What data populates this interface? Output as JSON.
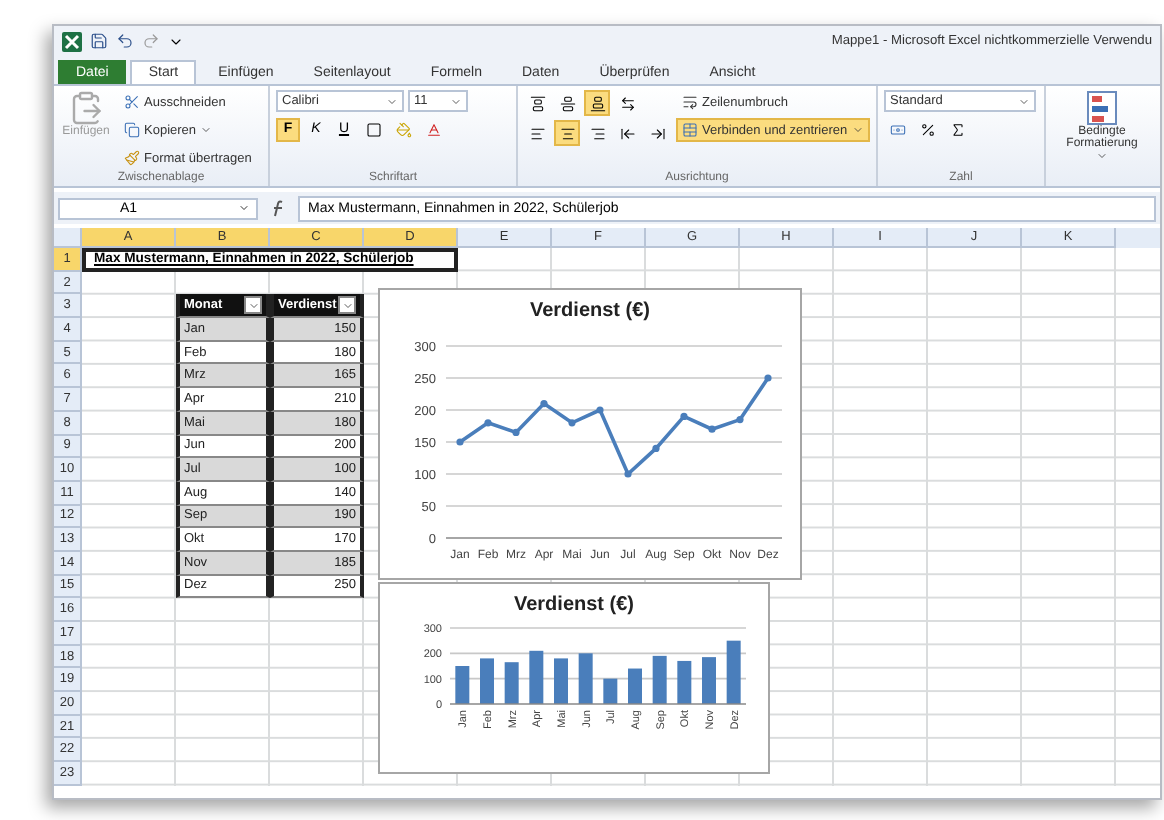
{
  "window": {
    "title": "Mappe1 - Microsoft Excel nichtkommerzielle Verwendu"
  },
  "ribbon_tabs": [
    {
      "label": "Datei",
      "kind": "file",
      "selected": false
    },
    {
      "label": "Start",
      "kind": "tab",
      "selected": true
    },
    {
      "label": "Einfügen",
      "kind": "tab",
      "selected": false
    },
    {
      "label": "Seitenlayout",
      "kind": "tab",
      "selected": false
    },
    {
      "label": "Formeln",
      "kind": "tab",
      "selected": false
    },
    {
      "label": "Daten",
      "kind": "tab",
      "selected": false
    },
    {
      "label": "Überprüfen",
      "kind": "tab",
      "selected": false
    },
    {
      "label": "Ansicht",
      "kind": "tab",
      "selected": false
    }
  ],
  "ribbon_groups": [
    {
      "kind": "clipboard",
      "label": "Zwischenablage",
      "paste": "Einfügen",
      "items": [
        "Ausschneiden",
        "Kopieren",
        "Format übertragen"
      ]
    },
    {
      "kind": "font",
      "label": "Schriftart",
      "font_name": "Calibri",
      "font_size": "11",
      "styles": [
        {
          "label": "F",
          "selected": true
        },
        {
          "label": "K",
          "selected": false
        },
        {
          "label": "U",
          "selected": false
        }
      ]
    },
    {
      "kind": "alignment",
      "label": "Ausrichtung",
      "wrap": "Zeilenumbruch",
      "merge": {
        "label": "Verbinden und zentrieren",
        "selected": true
      },
      "vertical": [
        {
          "selected": false
        },
        {
          "selected": false
        },
        {
          "selected": true
        }
      ],
      "horizontal": [
        {
          "selected": false
        },
        {
          "selected": true
        },
        {
          "selected": false
        }
      ]
    },
    {
      "kind": "number",
      "label": "Zahl",
      "format": "Standard"
    },
    {
      "kind": "styles",
      "label": "Bedingte Formatierung"
    }
  ],
  "formula_bar": {
    "name_box": "A1",
    "value": "Max Mustermann, Einnahmen in 2022, Schülerjob"
  },
  "sheet": {
    "columns": [
      {
        "label": "A",
        "selected": true
      },
      {
        "label": "B",
        "selected": true
      },
      {
        "label": "C",
        "selected": true
      },
      {
        "label": "D",
        "selected": true
      },
      {
        "label": "E",
        "selected": false
      },
      {
        "label": "F",
        "selected": false
      },
      {
        "label": "G",
        "selected": false
      },
      {
        "label": "H",
        "selected": false
      },
      {
        "label": "I",
        "selected": false
      },
      {
        "label": "J",
        "selected": false
      },
      {
        "label": "K",
        "selected": false
      }
    ],
    "row_numbers": [
      {
        "label": "1",
        "selected": true
      },
      {
        "label": "2",
        "selected": false
      },
      {
        "label": "3",
        "selected": false
      },
      {
        "label": "4",
        "selected": false
      },
      {
        "label": "5",
        "selected": false
      },
      {
        "label": "6",
        "selected": false
      },
      {
        "label": "7",
        "selected": false
      },
      {
        "label": "8",
        "selected": false
      },
      {
        "label": "9",
        "selected": false
      },
      {
        "label": "10",
        "selected": false
      },
      {
        "label": "11",
        "selected": false
      },
      {
        "label": "12",
        "selected": false
      },
      {
        "label": "13",
        "selected": false
      },
      {
        "label": "14",
        "selected": false
      },
      {
        "label": "15",
        "selected": false
      },
      {
        "label": "16",
        "selected": false
      },
      {
        "label": "17",
        "selected": false
      },
      {
        "label": "18",
        "selected": false
      },
      {
        "label": "19",
        "selected": false
      },
      {
        "label": "20",
        "selected": false
      },
      {
        "label": "21",
        "selected": false
      },
      {
        "label": "22",
        "selected": false
      },
      {
        "label": "23",
        "selected": false
      }
    ],
    "title_cell": {
      "text": "Max Mustermann, Einnahmen in 2022, Schülerjob",
      "selected": true
    }
  },
  "table": {
    "columns": [
      "Monat",
      "Verdienst"
    ],
    "rows": [
      [
        "Jan",
        "150"
      ],
      [
        "Feb",
        "180"
      ],
      [
        "Mrz",
        "165"
      ],
      [
        "Apr",
        "210"
      ],
      [
        "Mai",
        "180"
      ],
      [
        "Jun",
        "200"
      ],
      [
        "Jul",
        "100"
      ],
      [
        "Aug",
        "140"
      ],
      [
        "Sep",
        "190"
      ],
      [
        "Okt",
        "170"
      ],
      [
        "Nov",
        "185"
      ],
      [
        "Dez",
        "250"
      ]
    ]
  },
  "charts": [
    {
      "chart_data": {
        "type": "line",
        "title": "Verdienst (€)",
        "categories": [
          "Jan",
          "Feb",
          "Mrz",
          "Apr",
          "Mai",
          "Jun",
          "Jul",
          "Aug",
          "Sep",
          "Okt",
          "Nov",
          "Dez"
        ],
        "series": [
          {
            "color": "#4a7ebb",
            "marker": true,
            "values": [
              150,
              180,
              165,
              210,
              180,
              200,
              100,
              140,
              190,
              170,
              185,
              250
            ]
          }
        ],
        "ylim": [
          0,
          300
        ],
        "yticks": [
          0,
          50,
          100,
          150,
          200,
          250,
          300
        ],
        "grid": true
      }
    },
    {
      "chart_data": {
        "type": "bar",
        "title": "Verdienst (€)",
        "categories": [
          "Jan",
          "Feb",
          "Mrz",
          "Apr",
          "Mai",
          "Jun",
          "Jul",
          "Aug",
          "Sep",
          "Okt",
          "Nov",
          "Dez"
        ],
        "series": [
          {
            "color": "#4a7ebb",
            "values": [
              150,
              180,
              165,
              210,
              180,
              200,
              100,
              140,
              190,
              170,
              185,
              250
            ]
          }
        ],
        "ylim": [
          0,
          300
        ],
        "yticks": [
          0,
          100,
          200,
          300
        ],
        "grid": true
      }
    }
  ]
}
